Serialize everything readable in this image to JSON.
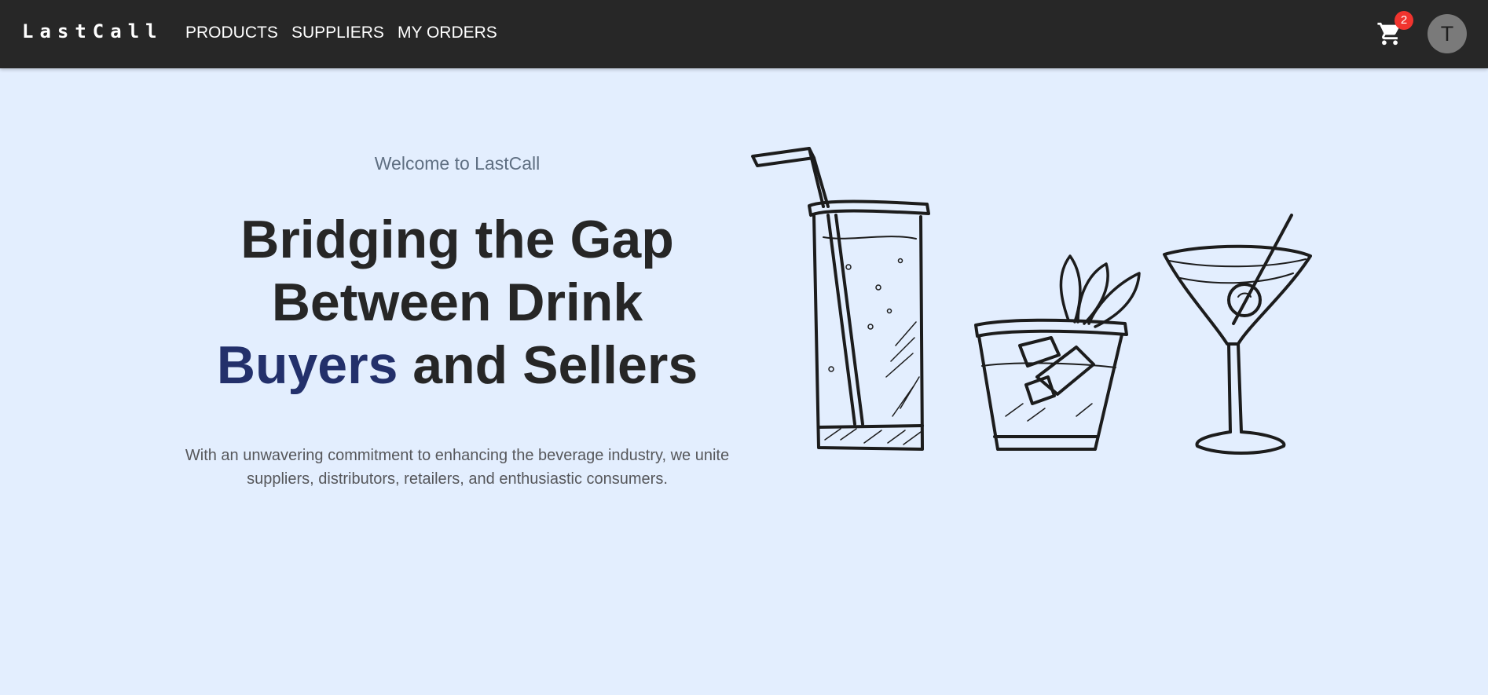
{
  "navbar": {
    "logo": "LastCall",
    "links": [
      "PRODUCTS",
      "SUPPLIERS",
      "MY ORDERS"
    ],
    "cart_icon": "shopping-cart-icon",
    "cart_count": "2",
    "avatar_initial": "T"
  },
  "hero": {
    "welcome": "Welcome to LastCall",
    "headline_part1": "Bridging the Gap Between Drink ",
    "headline_accent": "Buyers",
    "headline_part2": " and Sellers",
    "subtext": "With an unwavering commitment to enhancing the beverage industry, we unite suppliers, distributors, retailers, and enthusiastic consumers.",
    "illustration": "cocktail-drinks-illustration"
  },
  "colors": {
    "navbar_bg": "#272727",
    "page_bg": "#e3eefe",
    "accent": "#23306b",
    "badge": "#f1342e"
  }
}
